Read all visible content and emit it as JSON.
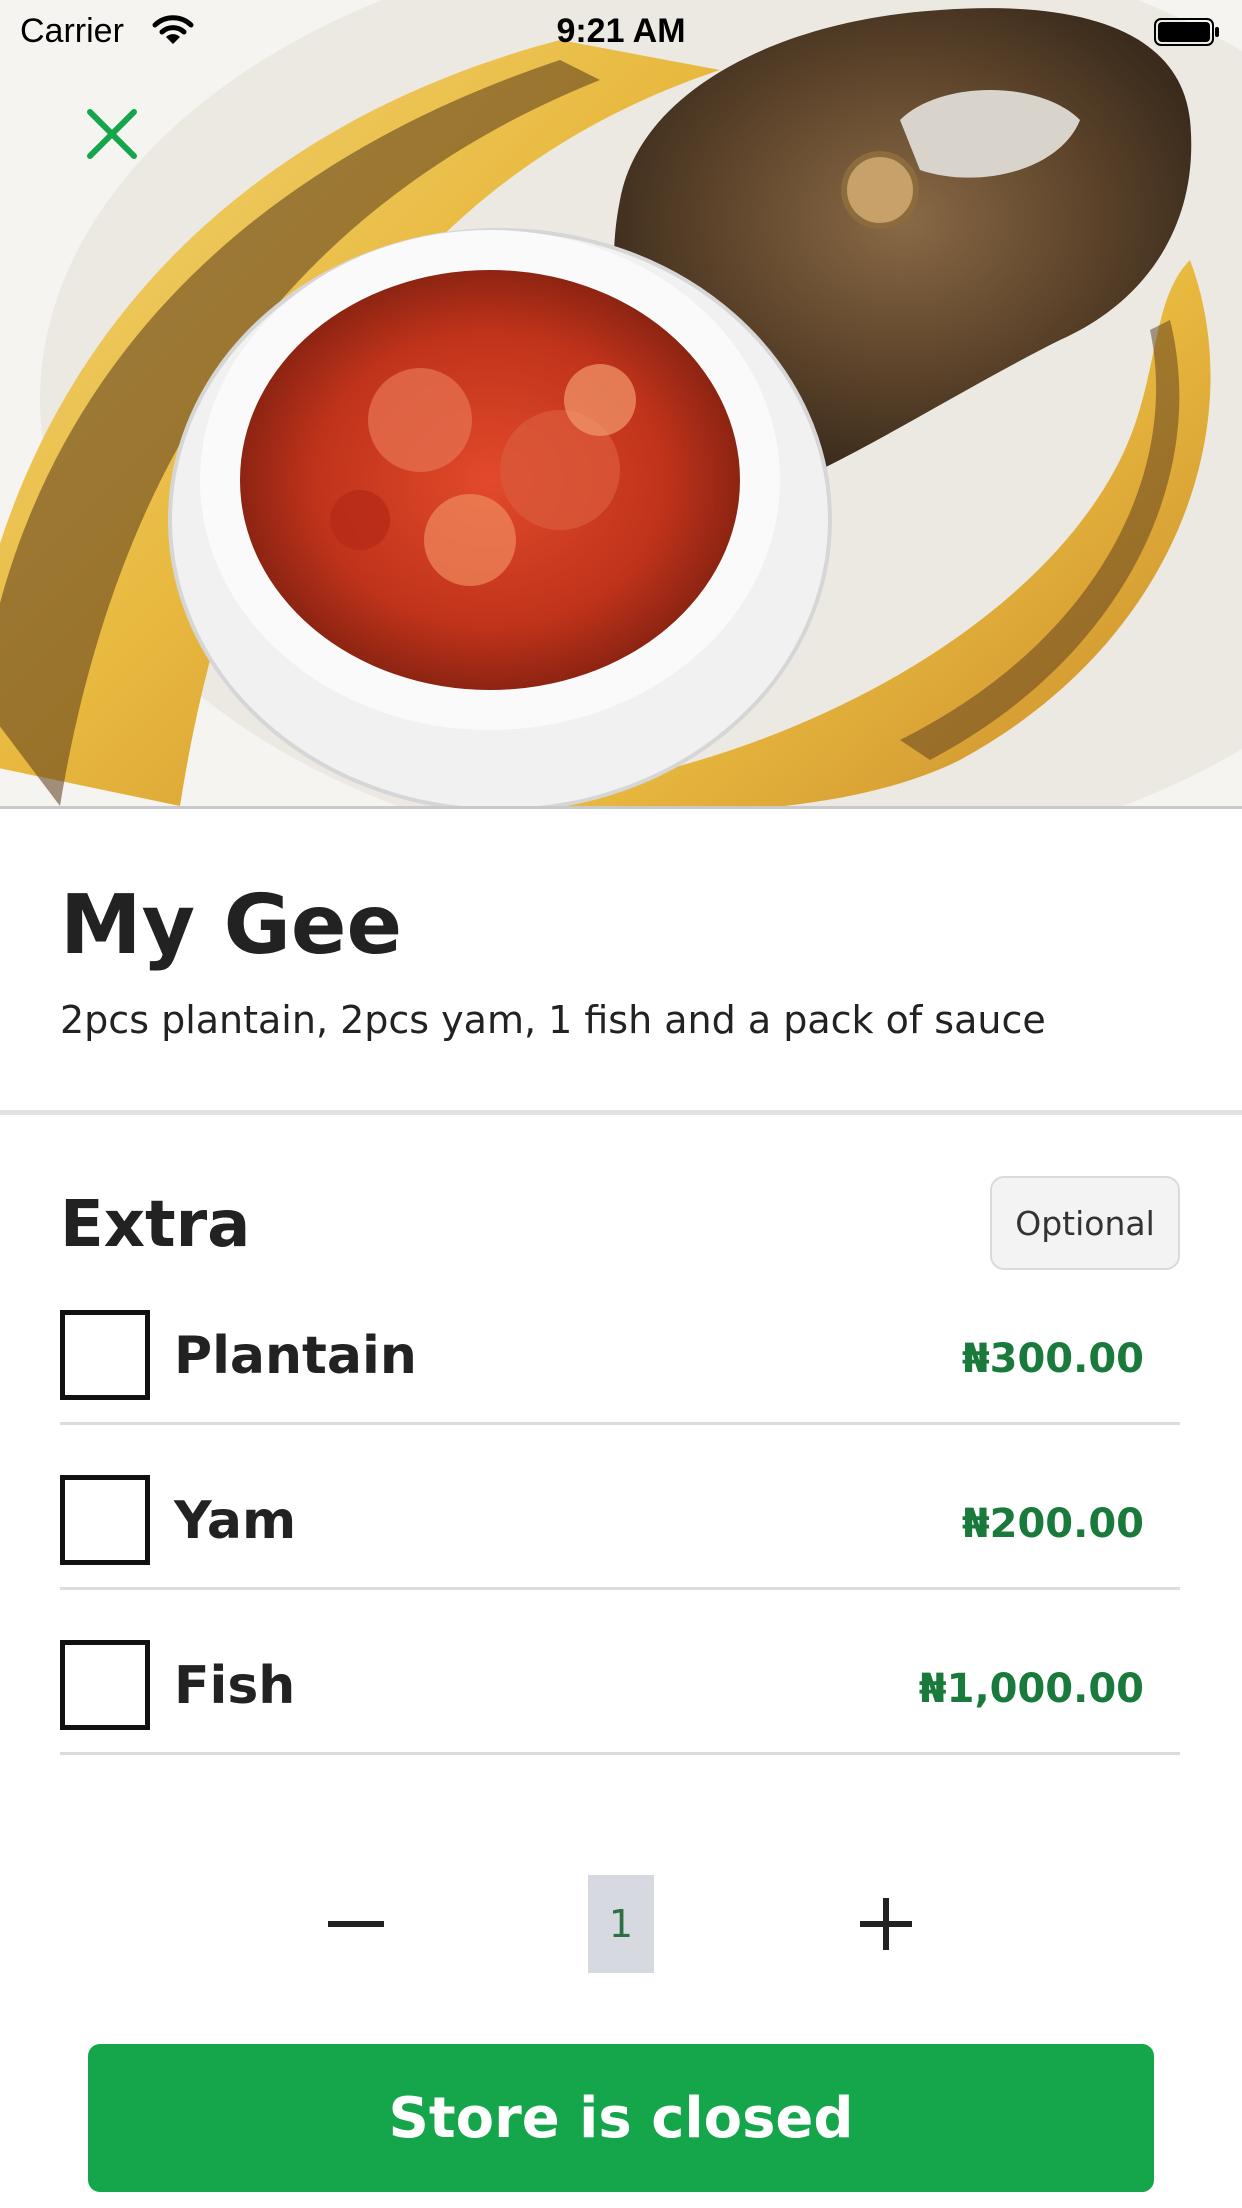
{
  "status_bar": {
    "carrier": "Carrier",
    "time": "9:21 AM"
  },
  "product": {
    "name": "My Gee",
    "description": "2pcs plantain, 2pcs yam, 1 fish and a pack of sauce"
  },
  "extras": {
    "heading": "Extra",
    "badge": "Optional",
    "items": [
      {
        "name": "Plantain",
        "price": "₦300.00",
        "checked": false
      },
      {
        "name": "Yam",
        "price": "₦200.00",
        "checked": false
      },
      {
        "name": "Fish",
        "price": "₦1,000.00",
        "checked": false
      }
    ]
  },
  "quantity": {
    "value": "1"
  },
  "cta": {
    "label": "Store is closed"
  },
  "colors": {
    "accent": "#15a54b",
    "price": "#1a7a3c"
  }
}
